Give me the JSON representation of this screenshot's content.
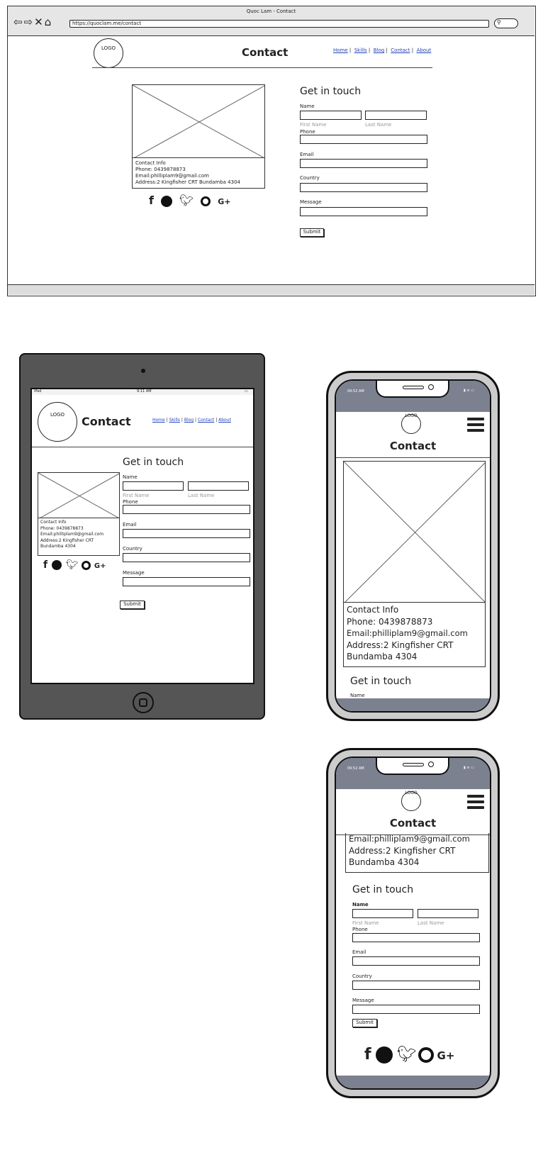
{
  "browser": {
    "title": "Quoc Lam - Contact",
    "url": "https://quoclam.me/contact"
  },
  "page": {
    "logo": "LOGO",
    "heading": "Contact",
    "nav": [
      "Home",
      "Skills",
      "Blog",
      "Contact",
      "About"
    ],
    "form_title": "Get in touch",
    "labels": {
      "name": "Name",
      "first": "First Name",
      "last": "Last Name",
      "phone": "Phone",
      "email": "Email",
      "country": "Country",
      "message": "Message"
    },
    "submit": "Submit",
    "contact": {
      "title": "Contact Info",
      "phone": "Phone: 0439878873",
      "email": "Email:philliplam9@gmail.com",
      "address": "Address:2 Kingfisher CRT Bundamba 4304",
      "address_l1": "Address:2 Kingfisher CRT",
      "address_l2": "Bundamba 4304"
    },
    "social": [
      "facebook-icon",
      "reddit-icon",
      "twitter-icon",
      "github-icon",
      "google-plus-icon"
    ]
  },
  "tablet": {
    "status_left": "iPad",
    "status_time": "9:11 AM"
  },
  "phone": {
    "status_time": "09:52 AM"
  }
}
